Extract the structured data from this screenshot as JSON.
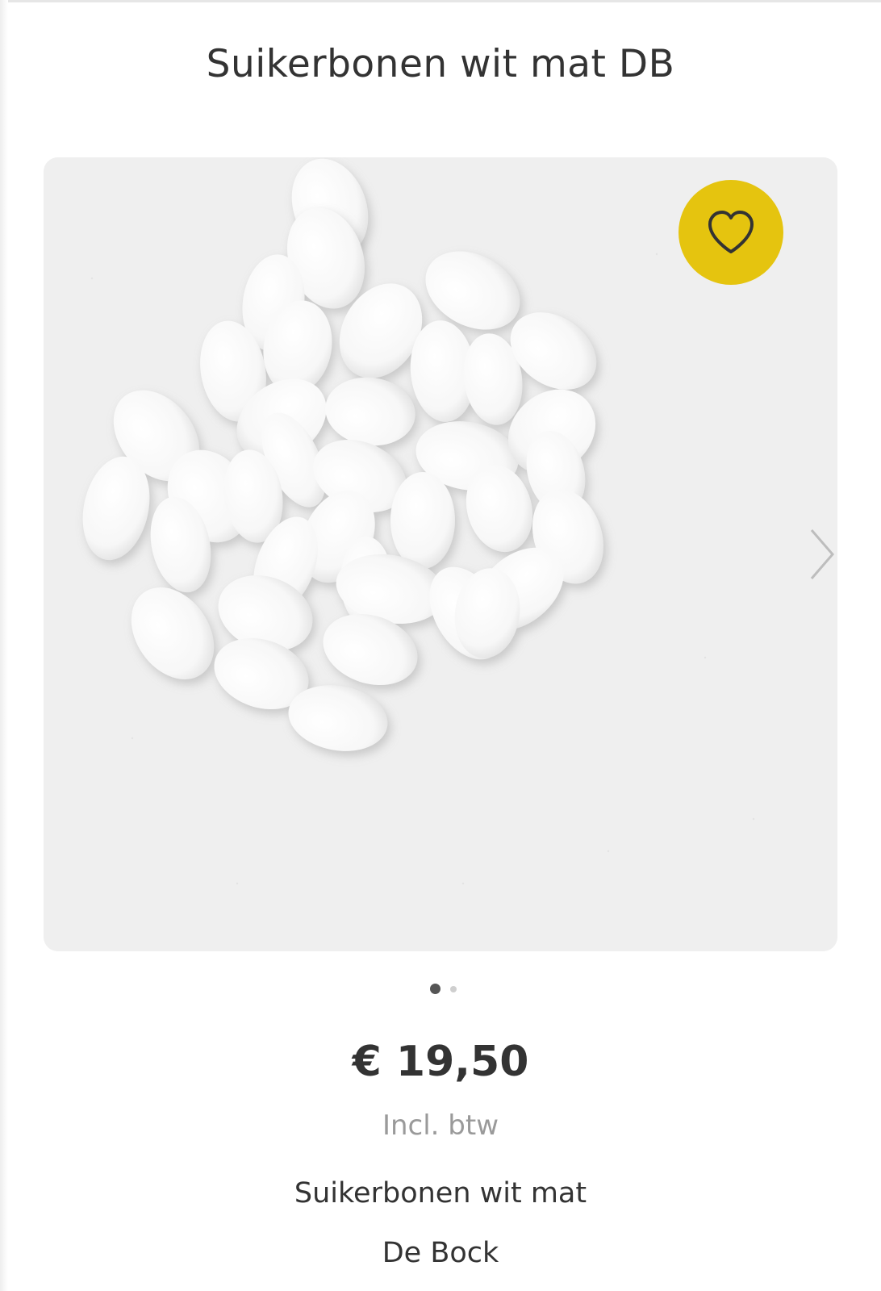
{
  "product": {
    "title": "Suikerbonen wit mat DB",
    "price": "€ 19,50",
    "tax_note": "Incl. btw",
    "name": "Suikerbonen wit mat",
    "brand": "De Bock"
  },
  "gallery": {
    "image_count": 2,
    "active_index": 0,
    "image_subject": "white matte sugared almonds on light grey surface"
  },
  "icons": {
    "favorite": "heart-outline-icon",
    "next": "chevron-right-icon"
  },
  "colors": {
    "favorite_bg": "#e5c40f",
    "text": "#333333",
    "muted_text": "#9a9a9a",
    "image_bg": "#efefef",
    "dot_active": "#555555",
    "dot_inactive": "#cfcfcf"
  }
}
